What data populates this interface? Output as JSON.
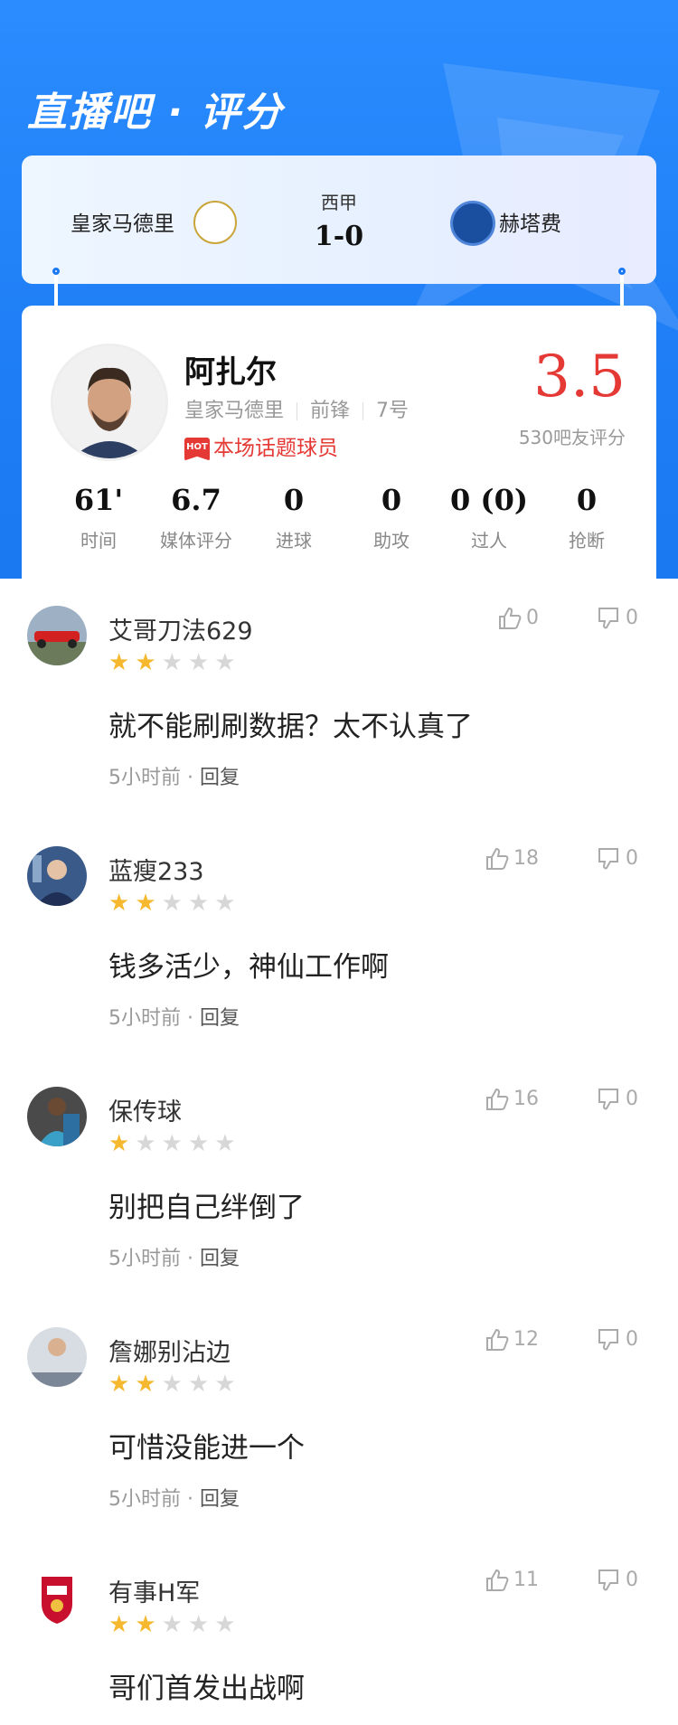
{
  "header": {
    "title": "直播吧 · 评分"
  },
  "match": {
    "home_team": "皇家马德里",
    "away_team": "赫塔费",
    "league": "西甲",
    "score": "1-0"
  },
  "player": {
    "name": "阿扎尔",
    "team": "皇家马德里",
    "position": "前锋",
    "number": "7号",
    "hot_label": "本场话题球员",
    "hot_tag": "HOT",
    "rating": "3.5",
    "rating_count": "530吧友评分"
  },
  "stats": [
    {
      "value": "61'",
      "label": "时间"
    },
    {
      "value": "6.7",
      "label": "媒体评分"
    },
    {
      "value": "0",
      "label": "进球"
    },
    {
      "value": "0",
      "label": "助攻"
    },
    {
      "value": "0 (0)",
      "label": "过人"
    },
    {
      "value": "0",
      "label": "抢断"
    }
  ],
  "comments": [
    {
      "user": "艾哥刀法629",
      "stars": 2,
      "text": "就不能刷刷数据？太不认真了",
      "time": "5小时前",
      "reply": "回复",
      "likes": "0",
      "dislikes": "0"
    },
    {
      "user": "蓝瘦233",
      "stars": 2,
      "text": "钱多活少，神仙工作啊",
      "time": "5小时前",
      "reply": "回复",
      "likes": "18",
      "dislikes": "0"
    },
    {
      "user": "保传球",
      "stars": 1,
      "text": "别把自己绊倒了",
      "time": "5小时前",
      "reply": "回复",
      "likes": "16",
      "dislikes": "0"
    },
    {
      "user": "詹娜别沾边",
      "stars": 2,
      "text": "可惜没能进一个",
      "time": "5小时前",
      "reply": "回复",
      "likes": "12",
      "dislikes": "0"
    },
    {
      "user": "有事H军",
      "stars": 2,
      "text": "哥们首发出战啊",
      "time": "",
      "reply": "",
      "likes": "11",
      "dislikes": "0"
    }
  ]
}
